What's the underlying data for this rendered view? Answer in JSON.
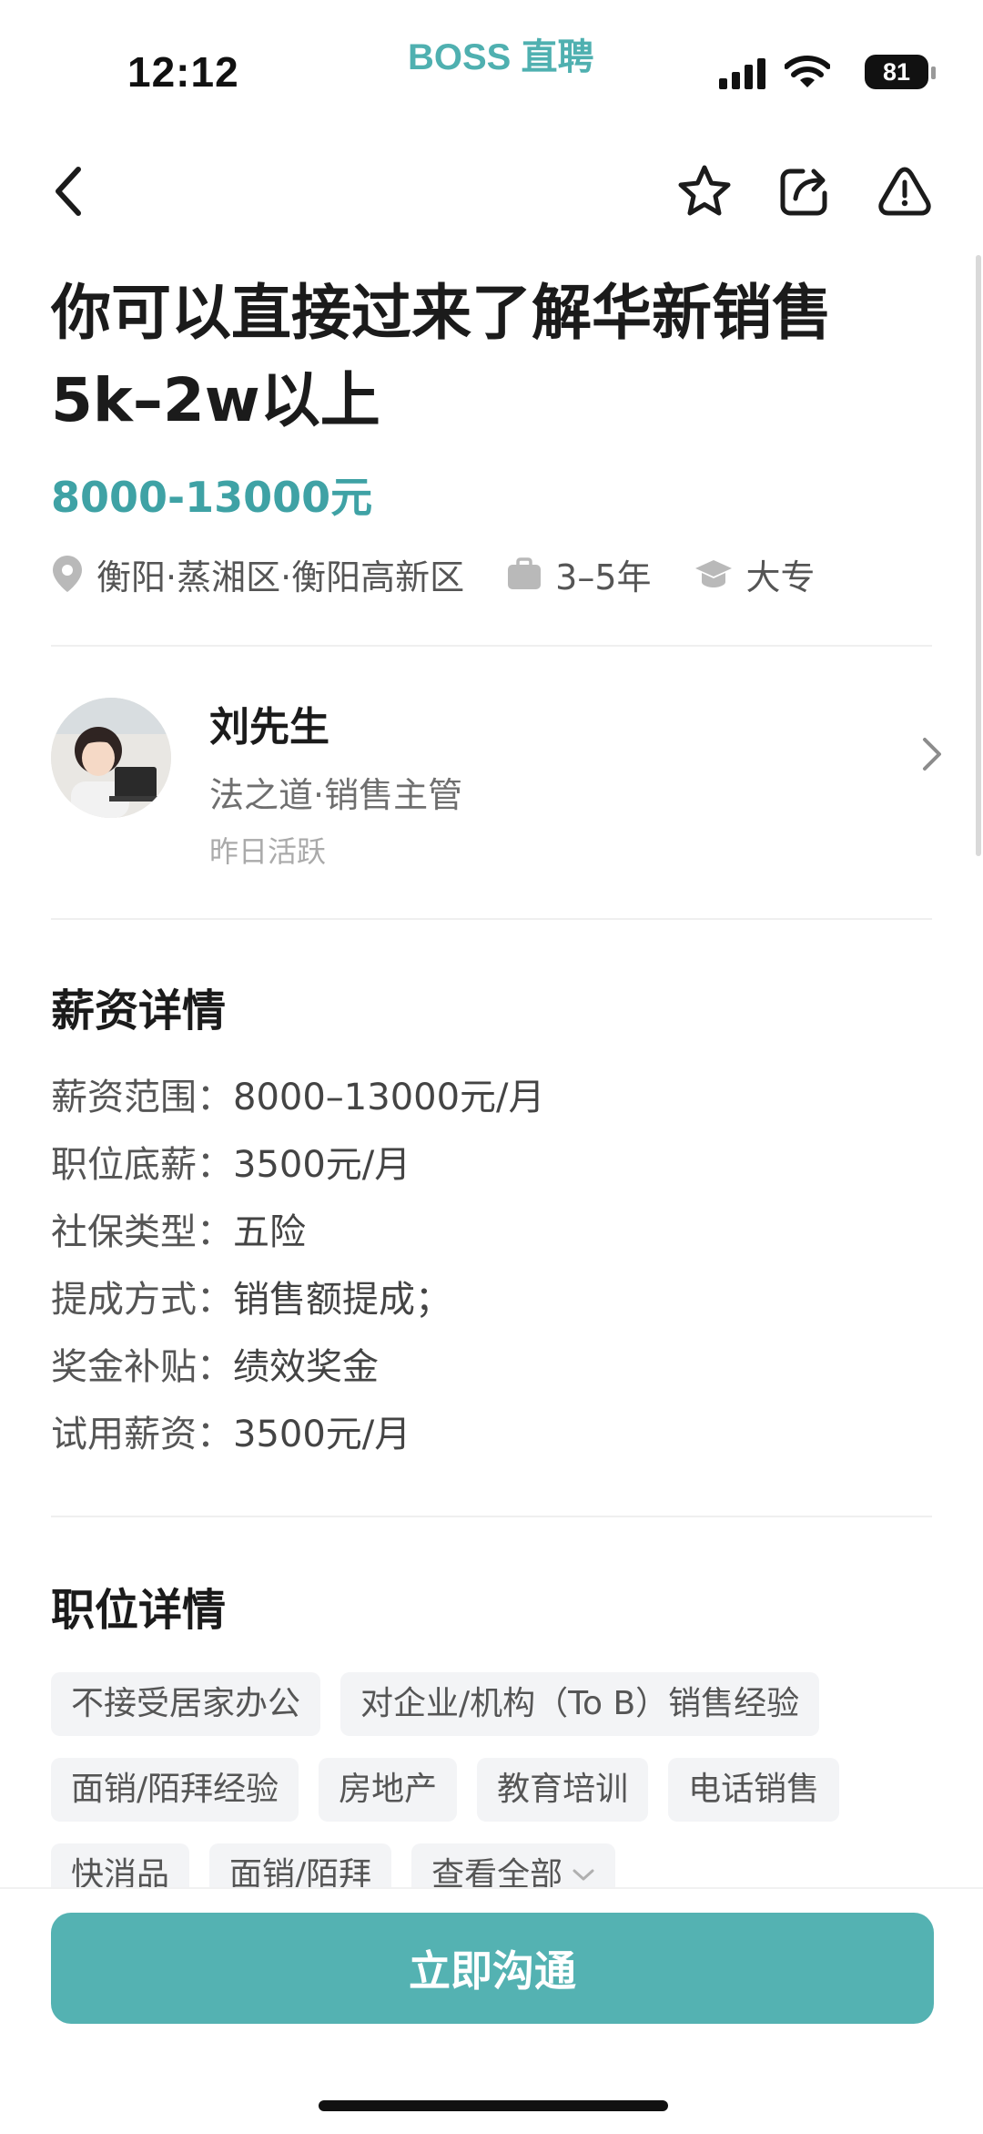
{
  "status_bar": {
    "time": "12:12",
    "brand": "BOSS 直聘",
    "battery": "81"
  },
  "nav": {
    "icons": [
      "back-icon",
      "star-icon",
      "share-icon",
      "report-icon"
    ]
  },
  "job": {
    "title": "你可以直接过来了解华新销售5k–2w以上",
    "salary": "8000-13000元",
    "location": "衡阳·蒸湘区·衡阳高新区",
    "experience": "3–5年",
    "education": "大专"
  },
  "recruiter": {
    "name": "刘先生",
    "company_position": "法之道·销售主管",
    "active_status": "昨日活跃"
  },
  "salary_details": {
    "title": "薪资详情",
    "rows": [
      {
        "label": "薪资范围：",
        "value": "8000–13000元/月"
      },
      {
        "label": "职位底薪：",
        "value": "3500元/月"
      },
      {
        "label": "社保类型：",
        "value": "五险"
      },
      {
        "label": "提成方式：",
        "value": "销售额提成；"
      },
      {
        "label": "奖金补贴：",
        "value": "绩效奖金"
      },
      {
        "label": "试用薪资：",
        "value": "3500元/月"
      }
    ]
  },
  "job_details": {
    "title": "职位详情",
    "tags": [
      "不接受居家办公",
      "对企业/机构（To B）销售经验",
      "面销/陌拜经验",
      "房地产",
      "教育培训",
      "电话销售",
      "快消品",
      "面销/陌拜"
    ],
    "view_all": "查看全部"
  },
  "action": {
    "chat_button": "立即沟通"
  },
  "colors": {
    "accent": "#3fa2a5",
    "button": "#54b2b2"
  }
}
